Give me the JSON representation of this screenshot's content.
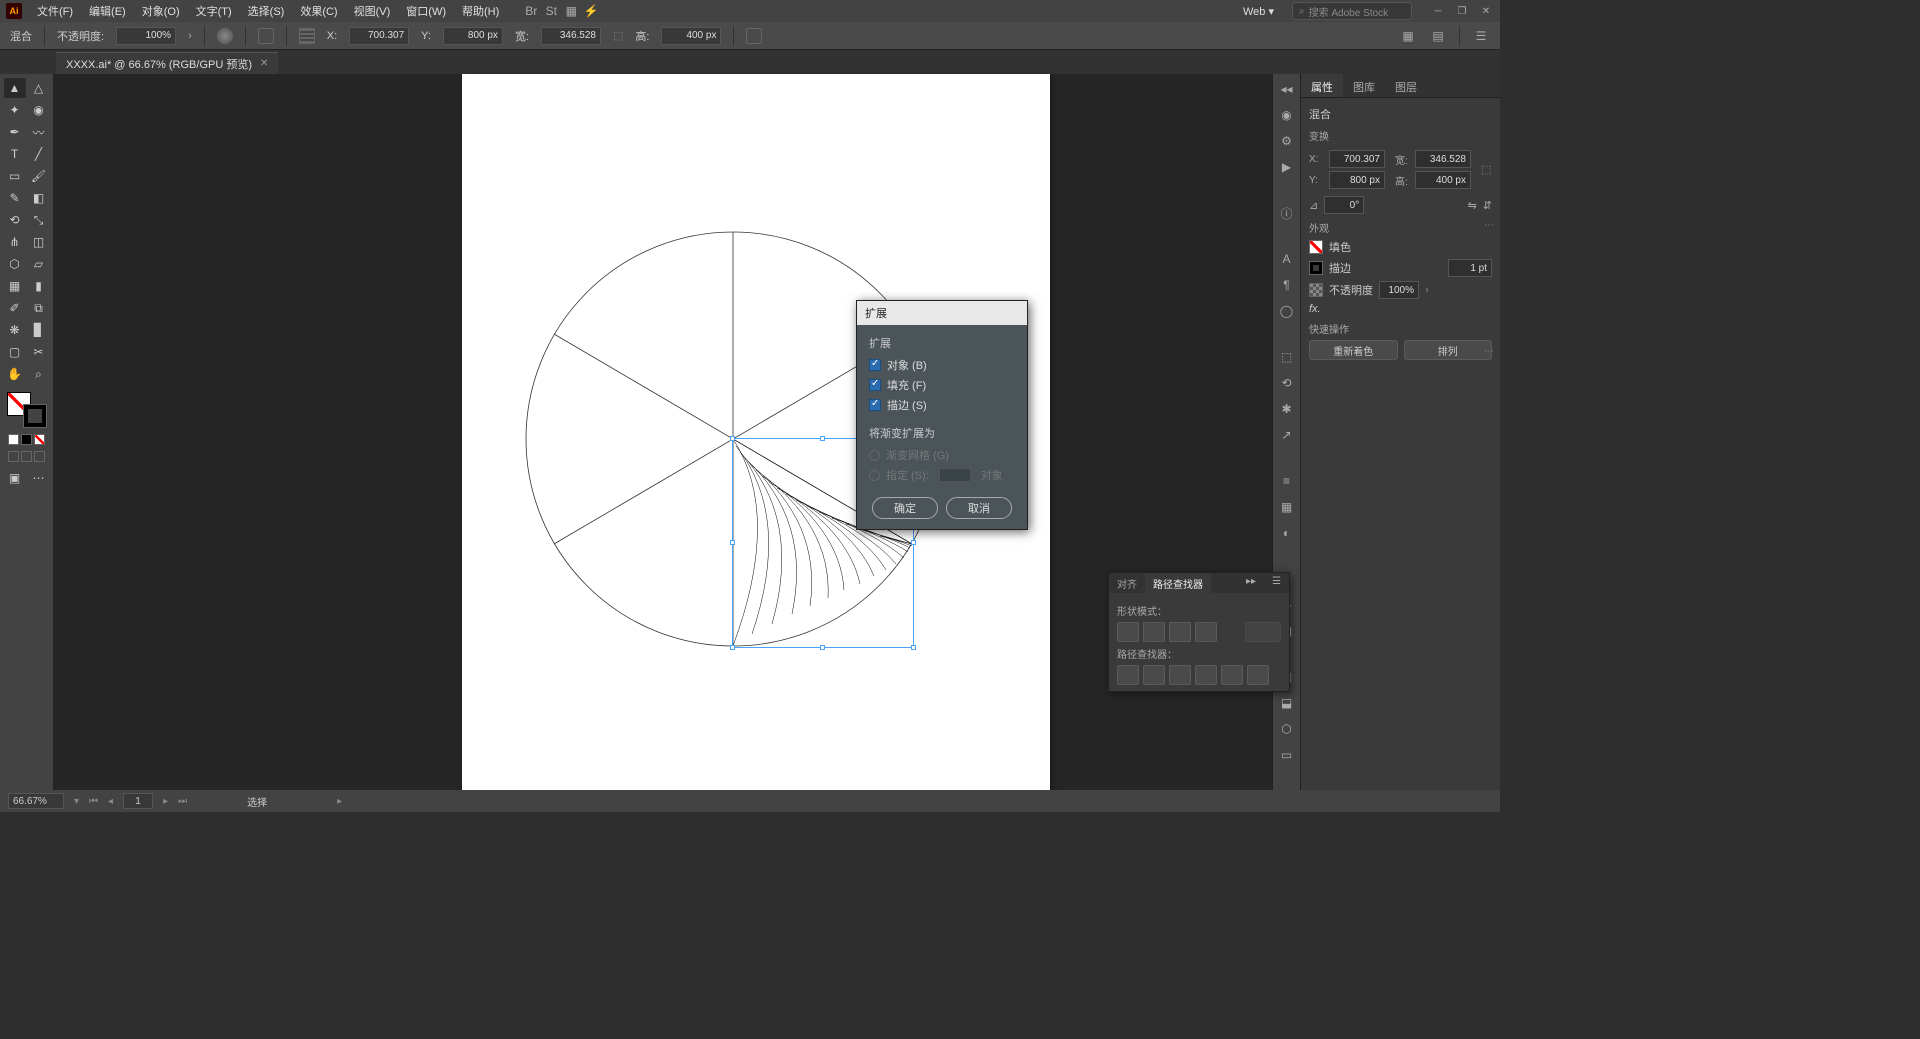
{
  "menubar": {
    "items": [
      "文件(F)",
      "编辑(E)",
      "对象(O)",
      "文字(T)",
      "选择(S)",
      "效果(C)",
      "视图(V)",
      "窗口(W)",
      "帮助(H)"
    ],
    "workspace": "Web",
    "search_placeholder": "搜索 Adobe Stock"
  },
  "controlbar": {
    "sel_label": "混合",
    "opacity_label": "不透明度:",
    "opacity_value": "100%",
    "x_label": "X:",
    "x_value": "700.307",
    "y_label": "Y:",
    "y_value": "800 px",
    "w_label": "宽:",
    "w_value": "346.528",
    "h_label": "高:",
    "h_value": "400 px"
  },
  "document": {
    "tab_label": "XXXX.ai* @ 66.67% (RGB/GPU 预览)"
  },
  "dialog": {
    "title": "扩展",
    "section1": "扩展",
    "check_object": "对象 (B)",
    "check_fill": "填充 (F)",
    "check_stroke": "描边 (S)",
    "section2": "将渐变扩展为",
    "radio_gradient": "渐变网格 (G)",
    "radio_specify": "指定 (S):",
    "specify_suffix": "对象",
    "ok": "确定",
    "cancel": "取消"
  },
  "pathfinder": {
    "tab_align": "对齐",
    "tab_pathfinder": "路径查找器",
    "shape_modes": "形状模式：",
    "pathfinders": "路径查找器："
  },
  "properties": {
    "tab_props": "属性",
    "tab_libs": "图库",
    "tab_layers": "图层",
    "obj_type": "混合",
    "transform": "变换",
    "x": "X:",
    "x_val": "700.307",
    "y": "Y:",
    "y_val": "800 px",
    "w": "宽:",
    "w_val": "346.528",
    "h": "高:",
    "h_val": "400 px",
    "rot": "0°",
    "appearance": "外观",
    "fill": "填色",
    "stroke": "描边",
    "stroke_weight": "1 pt",
    "opacity": "不透明度",
    "opacity_val": "100%",
    "fx": "fx.",
    "quick": "快速操作",
    "recolor": "重新着色",
    "arrange": "排列"
  },
  "status": {
    "zoom": "66.67%",
    "artboard_nav": "1",
    "tool": "选择"
  }
}
